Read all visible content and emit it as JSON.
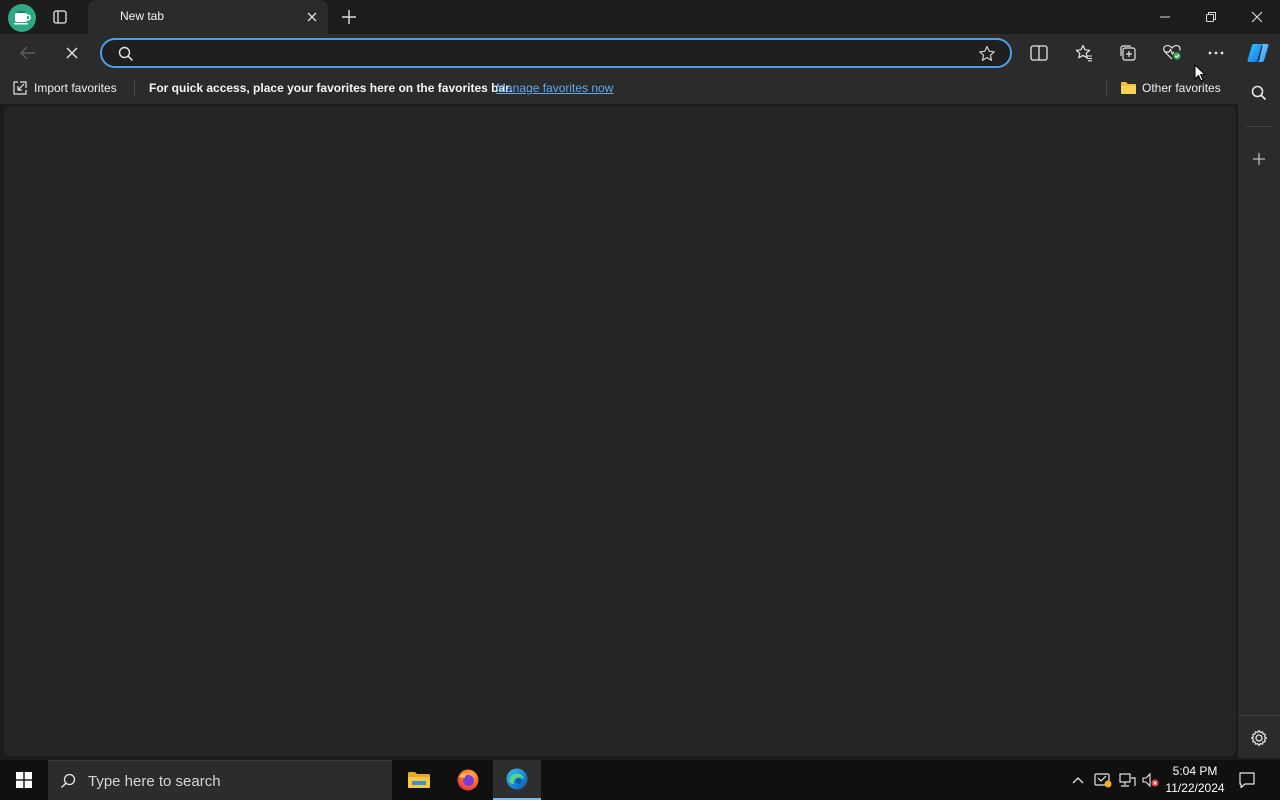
{
  "browser": {
    "tab": {
      "title": "New tab"
    },
    "address_bar": {
      "value": "",
      "placeholder": ""
    }
  },
  "favorites_bar": {
    "import_label": "Import favorites",
    "message": "For quick access, place your favorites here on the favorites bar.",
    "manage_link": "Manage favorites now",
    "other_favorites": "Other favorites"
  },
  "taskbar": {
    "search_placeholder": "Type here to search",
    "time": "5:04 PM",
    "date": "11/22/2024",
    "apps": [
      "file-explorer",
      "firefox",
      "edge"
    ]
  },
  "colors": {
    "accent": "#4d9ee8",
    "link": "#5da9f0",
    "profile": "#2fa886"
  }
}
